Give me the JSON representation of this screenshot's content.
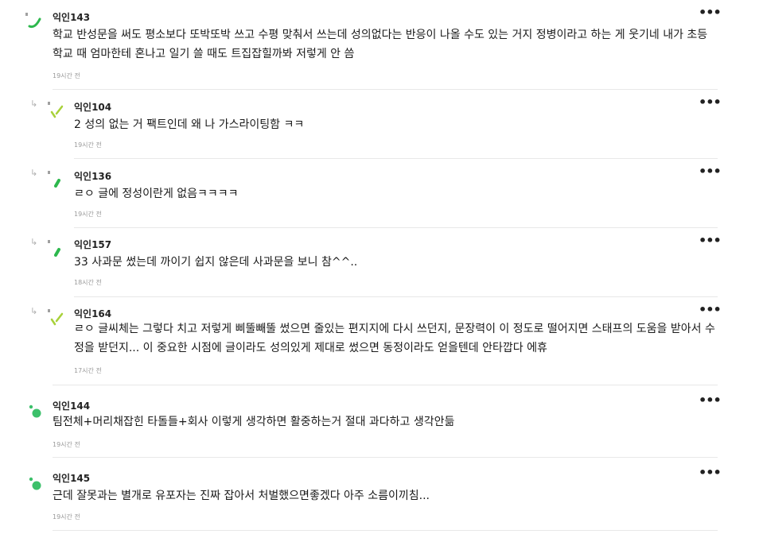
{
  "comments": [
    {
      "author": "익인143",
      "content": "학교 반성문을 써도 평소보다 또박또박 쓰고 수평 맞춰서 쓰는데 성의없다는 반응이 나올 수도 있는 거지 정병이라고 하는 게 웃기네 내가 초등학교 때 엄마한테 혼나고 일기 쓸 때도 트집잡힐까봐 저렇게 안 씀",
      "time": "19시간 전",
      "more": "•••",
      "avatar": "swoosh-icon",
      "color": "#2db84d"
    },
    {
      "author": "익인104",
      "content": "2 성의 없는 거 팩트인데 왜 나 가스라이팅함 ㅋㅋ",
      "time": "19시간 전",
      "more": "•••",
      "reply_icon": "↳",
      "avatar": "check-icon",
      "color": "#a8d13a"
    },
    {
      "author": "익인136",
      "content": "ㄹㅇ 글에 정성이란게 없음ㅋㅋㅋㅋ",
      "time": "19시간 전",
      "more": "•••",
      "reply_icon": "↳",
      "avatar": "slash-icon",
      "color": "#2db84d"
    },
    {
      "author": "익인157",
      "content": "33 사과문 썼는데 까이기 쉽지 않은데 사과문을 보니 참^^..",
      "time": "18시간 전",
      "more": "•••",
      "reply_icon": "↳",
      "avatar": "slash-icon",
      "color": "#2db84d"
    },
    {
      "author": "익인164",
      "content": "ㄹㅇ 글씨체는 그렇다 치고 저렇게 삐뚤빼뚤 썼으면 줄있는 편지지에 다시 쓰던지, 문장력이 이 정도로 떨어지면 스태프의 도움을 받아서 수정을 받던지... 이 중요한 시점에 글이라도 성의있게 제대로 썼으면 동정이라도 얻을텐데 안타깝다 에휴",
      "time": "17시간 전",
      "more": "•••",
      "reply_icon": "↳",
      "avatar": "check-icon",
      "color": "#a8d13a"
    },
    {
      "author": "익인144",
      "content": "팀전체+머리채잡힌 타돌들+회사 이렇게 생각하면 활중하는거 절대 과다하고 생각안듦",
      "time": "19시간 전",
      "more": "•••",
      "avatar": "dots-icon",
      "color": "#3cc06a"
    },
    {
      "author": "익인145",
      "content": "근데 잘못과는 별개로 유포자는 진짜 잡아서 처벌했으면좋겠다 아주 소름이끼침...",
      "time": "19시간 전",
      "more": "•••",
      "avatar": "dots-icon",
      "color": "#3cc06a"
    }
  ]
}
